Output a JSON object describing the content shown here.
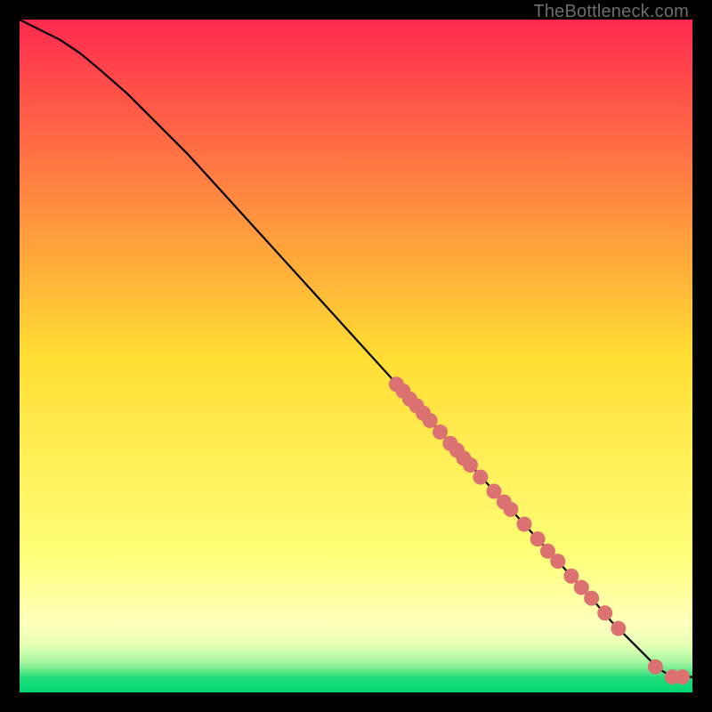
{
  "watermark": "TheBottleneck.com",
  "chart_data": {
    "type": "line",
    "title": "",
    "xlabel": "",
    "ylabel": "",
    "xlim": [
      0,
      100
    ],
    "ylim": [
      0,
      100
    ],
    "grid": false,
    "background_gradient": [
      {
        "pos": 0.0,
        "color": "#ff2a4f"
      },
      {
        "pos": 0.5,
        "color": "#ffdd33"
      },
      {
        "pos": 0.8,
        "color": "#ffff7a"
      },
      {
        "pos": 0.9,
        "color": "#fdffbd"
      },
      {
        "pos": 0.93,
        "color": "#e4ffb4"
      },
      {
        "pos": 0.955,
        "color": "#a6f7a0"
      },
      {
        "pos": 0.968,
        "color": "#63e989"
      },
      {
        "pos": 0.978,
        "color": "#20dd7a"
      },
      {
        "pos": 1.0,
        "color": "#00d873"
      }
    ],
    "curve": {
      "x": [
        0,
        3,
        6,
        9,
        12,
        16,
        20,
        25,
        30,
        35,
        40,
        45,
        50,
        55,
        60,
        65,
        70,
        75,
        80,
        85,
        88,
        91,
        93,
        95,
        97,
        100
      ],
      "y": [
        100,
        98.5,
        97,
        95,
        92.5,
        89,
        85,
        80,
        74.5,
        69,
        63.5,
        58,
        52.5,
        47,
        41.5,
        36,
        30.5,
        25,
        19.5,
        14,
        10.5,
        7.5,
        5.5,
        3.5,
        2.3,
        2.3
      ]
    },
    "series": [
      {
        "name": "points",
        "type": "scatter",
        "color": "#db7171",
        "x": [
          56,
          57,
          58,
          59,
          60,
          61,
          62.5,
          64,
          65,
          66,
          67,
          68.5,
          70.5,
          72,
          73,
          75,
          77,
          78.5,
          80,
          82,
          83.5,
          85,
          87,
          89,
          94.5,
          97,
          98.5
        ],
        "y": [
          45.8,
          44.8,
          43.6,
          42.6,
          41.5,
          40.4,
          38.7,
          37,
          36,
          34.8,
          33.8,
          32,
          29.9,
          28.3,
          27.2,
          25,
          22.8,
          21,
          19.5,
          17.3,
          15.6,
          14,
          11.8,
          9.5,
          3.8,
          2.3,
          2.3
        ]
      }
    ]
  }
}
